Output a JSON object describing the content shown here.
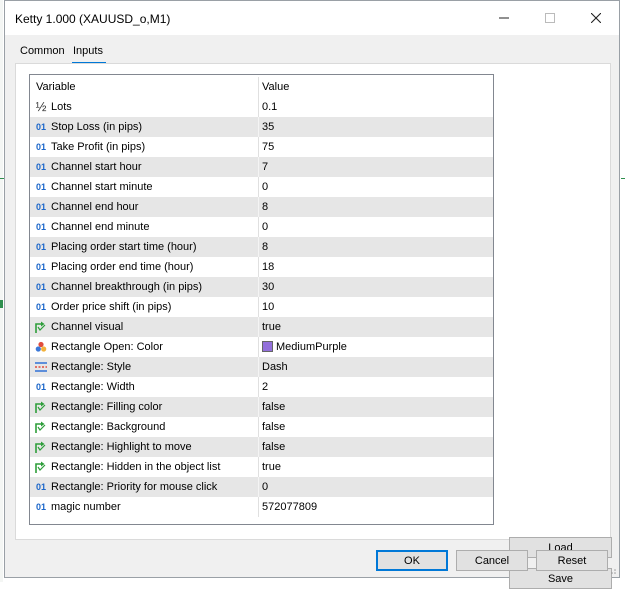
{
  "window": {
    "title": "Ketty 1.000 (XAUUSD_o,M1)"
  },
  "titlebar": {
    "minimize": "—",
    "maximize": "☐",
    "close": "✕"
  },
  "tabs": [
    {
      "label": "Common",
      "active": false
    },
    {
      "label": "Inputs",
      "active": true
    }
  ],
  "grid": {
    "columns": [
      "Variable",
      "Value"
    ],
    "rows": [
      {
        "icon": "half-icon",
        "glyph": "½",
        "variable": "Lots",
        "value": "0.1"
      },
      {
        "icon": "integer-icon",
        "glyph": "01",
        "variable": "Stop Loss (in pips)",
        "value": "35"
      },
      {
        "icon": "integer-icon",
        "glyph": "01",
        "variable": "Take Profit (in pips)",
        "value": "75"
      },
      {
        "icon": "integer-icon",
        "glyph": "01",
        "variable": "Channel start hour",
        "value": "7"
      },
      {
        "icon": "integer-icon",
        "glyph": "01",
        "variable": "Channel start minute",
        "value": "0"
      },
      {
        "icon": "integer-icon",
        "glyph": "01",
        "variable": "Channel end hour",
        "value": "8"
      },
      {
        "icon": "integer-icon",
        "glyph": "01",
        "variable": "Channel end minute",
        "value": "0"
      },
      {
        "icon": "integer-icon",
        "glyph": "01",
        "variable": "Placing order start time (hour)",
        "value": "8"
      },
      {
        "icon": "integer-icon",
        "glyph": "01",
        "variable": "Placing order end time (hour)",
        "value": "18"
      },
      {
        "icon": "integer-icon",
        "glyph": "01",
        "variable": "Channel breakthrough (in pips)",
        "value": "30"
      },
      {
        "icon": "integer-icon",
        "glyph": "01",
        "variable": "Order price shift (in pips)",
        "value": "10"
      },
      {
        "icon": "bool-icon",
        "glyph": "",
        "variable": "Channel visual",
        "value": "true"
      },
      {
        "icon": "color-icon",
        "glyph": "",
        "variable": "Rectangle Open: Color",
        "value": "MediumPurple",
        "swatch": "#9370db"
      },
      {
        "icon": "line-style-icon",
        "glyph": "",
        "variable": "Rectangle: Style",
        "value": "Dash"
      },
      {
        "icon": "integer-icon",
        "glyph": "01",
        "variable": "Rectangle: Width",
        "value": "2"
      },
      {
        "icon": "bool-icon",
        "glyph": "",
        "variable": "Rectangle: Filling  color",
        "value": "false"
      },
      {
        "icon": "bool-icon",
        "glyph": "",
        "variable": "Rectangle: Background",
        "value": "false"
      },
      {
        "icon": "bool-icon",
        "glyph": "",
        "variable": "Rectangle: Highlight to move",
        "value": "false"
      },
      {
        "icon": "bool-icon",
        "glyph": "",
        "variable": "Rectangle: Hidden in the object list",
        "value": "true"
      },
      {
        "icon": "integer-icon",
        "glyph": "01",
        "variable": "Rectangle: Priority for mouse click",
        "value": "0"
      },
      {
        "icon": "integer-icon",
        "glyph": "01",
        "variable": "magic number",
        "value": "572077809"
      }
    ]
  },
  "buttons": {
    "load": "Load",
    "save": "Save",
    "ok": "OK",
    "cancel": "Cancel",
    "reset": "Reset"
  },
  "colors": {
    "accent": "#0078d7",
    "integer_icon": "#1b66c9",
    "bool_icon": "#2e9e3a"
  }
}
